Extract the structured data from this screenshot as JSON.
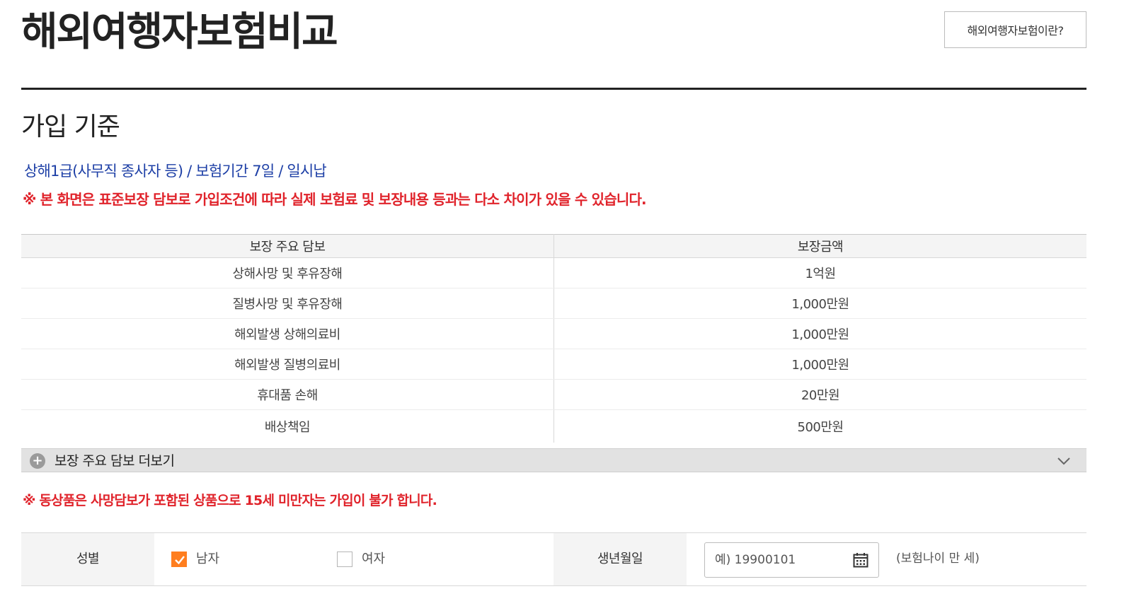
{
  "header": {
    "title": "해외여행자보험비교",
    "about_button": "해외여행자보험이란?"
  },
  "criteria": {
    "heading": "가입 기준",
    "summary": "상해1급(사무직 종사자 등) / 보험기간 7일 / 일시납",
    "notice": "※ 본 화면은 표준보장 담보로 가입조건에 따라 실제 보험료 및 보장내용 등과는 다소 차이가 있을 수 있습니다."
  },
  "coverage": {
    "headers": [
      "보장 주요 담보",
      "보장금액"
    ],
    "rows": [
      {
        "item": "상해사망 및 후유장해",
        "amount": "1억원"
      },
      {
        "item": "질병사망 및 후유장해",
        "amount": "1,000만원"
      },
      {
        "item": "해외발생 상해의료비",
        "amount": "1,000만원"
      },
      {
        "item": "해외발생 질병의료비",
        "amount": "1,000만원"
      },
      {
        "item": "휴대품 손해",
        "amount": "20만원"
      },
      {
        "item": "배상책임",
        "amount": "500만원"
      }
    ],
    "more_label": "보장 주요 담보 더보기"
  },
  "age_notice": "※ 동상품은 사망담보가 포함된 상품으로 15세 미만자는 가입이 불가 합니다.",
  "form": {
    "gender_label": "성별",
    "gender_options": [
      {
        "label": "남자",
        "checked": true
      },
      {
        "label": "여자",
        "checked": false
      }
    ],
    "birth_label": "생년월일",
    "birth_placeholder": "예) 19900101",
    "birth_value": "",
    "age_text": "(보험나이 만      세)"
  },
  "colors": {
    "accent_blue": "#1d3fa6",
    "notice_red": "#e0232b",
    "checkbox_orange": "#ff7e1f"
  },
  "icons": {
    "more": "plus-circle-icon",
    "expand": "chevron-down-icon",
    "checkbox_checked": "checkmark-icon",
    "calendar": "calendar-icon"
  }
}
